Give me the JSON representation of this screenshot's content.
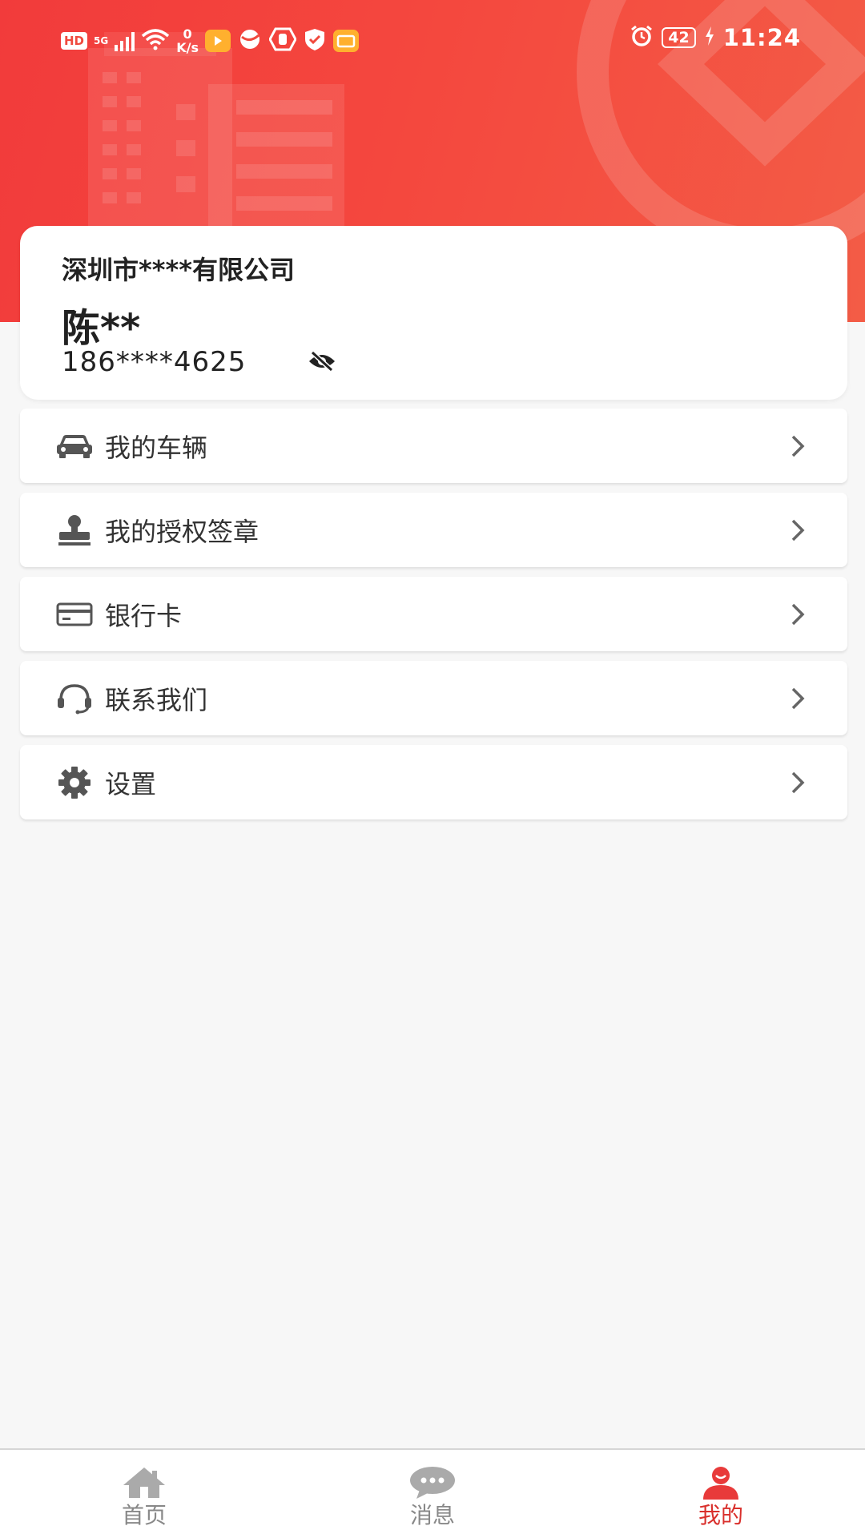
{
  "status_bar": {
    "hd": "HD",
    "signal_type": "5G",
    "speed_value": "0",
    "speed_unit": "K/s",
    "battery": "42",
    "time": "11:24"
  },
  "profile": {
    "company": "深圳市****有限公司",
    "name": "陈**",
    "phone": "186****4625"
  },
  "menu": {
    "items": [
      {
        "label": "我的车辆",
        "icon": "car-icon"
      },
      {
        "label": "我的授权签章",
        "icon": "stamp-icon"
      },
      {
        "label": "银行卡",
        "icon": "bank-card-icon"
      },
      {
        "label": "联系我们",
        "icon": "headset-icon"
      },
      {
        "label": "设置",
        "icon": "gear-icon"
      }
    ]
  },
  "bottom_nav": {
    "items": [
      {
        "label": "首页",
        "icon": "home-icon"
      },
      {
        "label": "消息",
        "icon": "message-icon"
      },
      {
        "label": "我的",
        "icon": "user-icon",
        "active": true
      }
    ]
  },
  "colors": {
    "header_red": "#f23b3b",
    "active_red": "#d9302c",
    "inactive_gray": "#888888"
  }
}
